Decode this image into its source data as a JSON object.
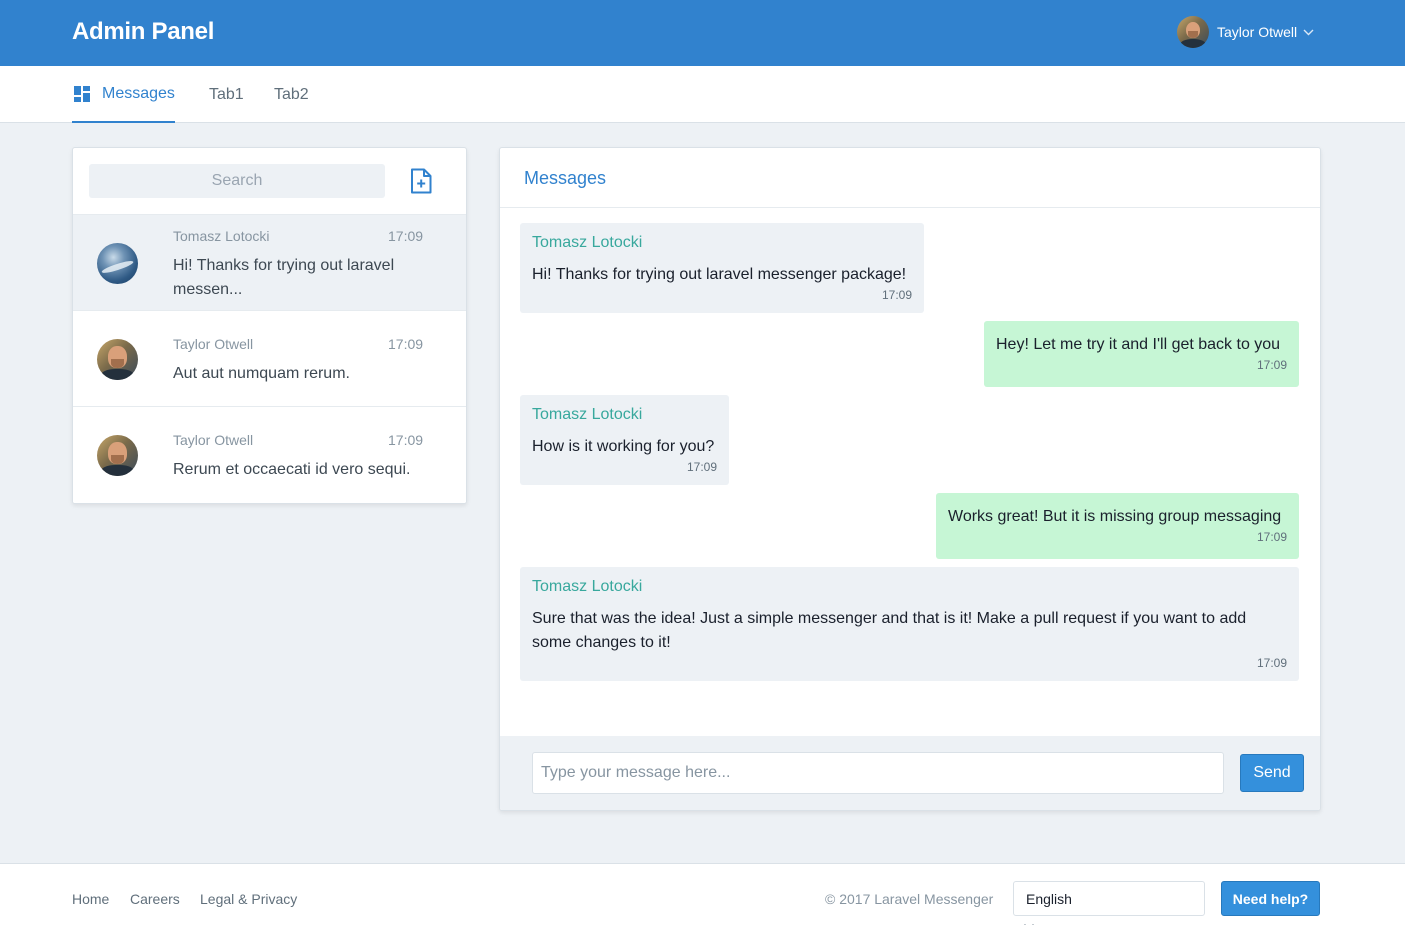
{
  "app": {
    "brand": "Admin Panel"
  },
  "user": {
    "name": "Taylor Otwell",
    "avatar_icon": "user-avatar"
  },
  "tabs": [
    {
      "label": "Messages",
      "icon": "dashboard-icon",
      "active": true
    },
    {
      "label": "Tab1",
      "active": false
    },
    {
      "label": "Tab2",
      "active": false
    }
  ],
  "threads": {
    "search_placeholder": "Search",
    "new_icon": "new-document-icon",
    "items": [
      {
        "name": "Tomasz Lotocki",
        "time": "17:09",
        "preview": "Hi! Thanks for trying out laravel messen...",
        "selected": true
      },
      {
        "name": "Taylor Otwell",
        "time": "17:09",
        "preview": "Aut aut numquam rerum.",
        "selected": false
      },
      {
        "name": "Taylor Otwell",
        "time": "17:09",
        "preview": "Rerum et occaecati id vero sequi.",
        "selected": false
      }
    ]
  },
  "conversation": {
    "title": "Messages",
    "messages": [
      {
        "direction": "in",
        "sender": "Tomasz Lotocki",
        "text": "Hi! Thanks for trying out laravel messenger package!",
        "time": "17:09"
      },
      {
        "direction": "out",
        "text": "Hey! Let me try it and I'll get back to you",
        "time": "17:09"
      },
      {
        "direction": "in",
        "sender": "Tomasz Lotocki",
        "text": "How is it working for you?",
        "time": "17:09"
      },
      {
        "direction": "out",
        "text": "Works great! But it is missing group messaging",
        "time": "17:09"
      },
      {
        "direction": "in",
        "sender": "Tomasz Lotocki",
        "text": "Sure that was the idea! Just a simple messenger and that is it! Make a pull request if you want to add some changes to it!",
        "time": "17:09"
      }
    ],
    "composer": {
      "placeholder": "Type your message here...",
      "value": "",
      "send_label": "Send"
    }
  },
  "footer": {
    "links": [
      "Home",
      "Careers",
      "Legal & Privacy"
    ],
    "copyright": "© 2017 Laravel Messenger",
    "language": "English",
    "help_label": "Need help?"
  },
  "colors": {
    "primary": "#3182ce",
    "incoming_bubble": "#edf1f5",
    "outgoing_bubble": "#c6f6d5",
    "sender_name": "#38a89d"
  }
}
